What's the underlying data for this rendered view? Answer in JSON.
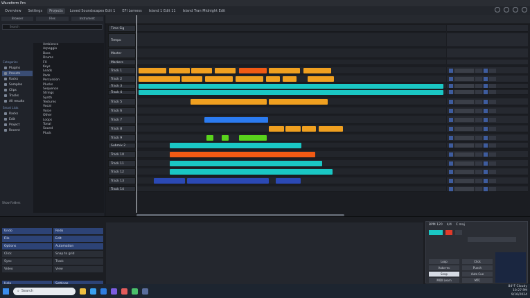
{
  "window": {
    "title": "Waveform Pro"
  },
  "tabs": [
    "Overview",
    "Settings",
    "Projects",
    "Loved Soundscapes Edit 1",
    "EFI Lerness",
    "Island 1 Edit 11",
    "Island Tran Midnight Edit"
  ],
  "left_panel": {
    "head_tabs": [
      "Browser",
      "Files",
      "Instrument"
    ],
    "search_placeholder": "Search",
    "categories_title": "Categories",
    "categories": [
      "Plugins",
      "Presets",
      "Racks",
      "Samples",
      "Clips",
      "Tracks",
      "All results"
    ],
    "smart_lists_title": "Smart Lists",
    "smart_lists": [
      "Racks",
      "Edit",
      "Project",
      "Recent"
    ],
    "files": [
      "Ambience",
      "Arpeggio",
      "Bass",
      "Drums",
      "FX",
      "Keys",
      "Leads",
      "Pads",
      "Percussion",
      "Plucks",
      "Sequence",
      "Strings",
      "Synth",
      "Textures",
      "Vocal",
      "Voice",
      "Other",
      "Loops",
      "Tonal",
      "Sound",
      "Pluck"
    ],
    "bottom_label": "Show Folders"
  },
  "tracks": [
    {
      "name": "Time Sig"
    },
    {
      "name": "Tempo"
    },
    {
      "name": "Master"
    },
    {
      "name": "Markers"
    },
    {
      "name": "Track 1"
    },
    {
      "name": "Track 2"
    },
    {
      "name": "Track 3"
    },
    {
      "name": "Track 4"
    },
    {
      "name": "Track 5"
    },
    {
      "name": "Track 6"
    },
    {
      "name": "Track 7"
    },
    {
      "name": "Track 8"
    },
    {
      "name": "Track 9"
    },
    {
      "name": "Submix 2"
    },
    {
      "name": "Track 10"
    },
    {
      "name": "Track 11"
    },
    {
      "name": "Track 12"
    },
    {
      "name": "Track 13"
    },
    {
      "name": "Track 14"
    }
  ],
  "bottom_panel": {
    "buttons": [
      [
        "Undo",
        "Redo"
      ],
      [
        "File",
        "Edit"
      ],
      [
        "Options",
        "Automation"
      ],
      [
        "Click",
        "Snap to grid"
      ],
      [
        "Sync",
        "Track"
      ],
      [
        "Video",
        "View"
      ]
    ],
    "help": "Help",
    "settings": "Settings"
  },
  "transport": {
    "bpm": "BPM 120",
    "signature": "4/4",
    "key": "C maj",
    "buttons": [
      "Loop",
      "Click",
      "Auto-rec",
      "Punch",
      "Snap",
      "Auto Cue",
      "MIDI Learn",
      "MTC"
    ]
  },
  "taskbar": {
    "search_placeholder": "Search",
    "weather": "84°F Cloudy",
    "time": "10:27 PM",
    "date": "9/16/2024"
  },
  "colors": {
    "orange": "#f0a020",
    "red": "#f25a14",
    "teal": "#1ac7c4",
    "blue": "#2b7bf0",
    "green": "#59d31c",
    "navy": "#2b49b5"
  }
}
